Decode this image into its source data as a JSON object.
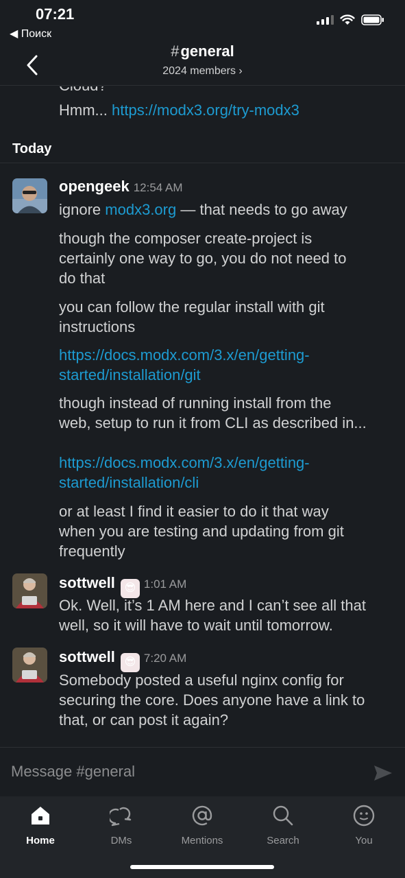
{
  "status_bar": {
    "time": "07:21",
    "back_app": "◀ Поиск"
  },
  "header": {
    "hash": "#",
    "channel": "general",
    "members": "2024 members ›"
  },
  "partial_top": {
    "cut_text": "Cloud?",
    "prefix": "Hmm... ",
    "link": "https://modx3.org/try-modx3"
  },
  "day_separator": "Today",
  "messages": [
    {
      "author": "opengeek",
      "time": "12:54 AM",
      "line1_prefix": "ignore ",
      "line1_link": "modx3.org",
      "line1_suffix": " — that needs to go away",
      "p2_l1": "though the composer create-project is",
      "p2_l2": "certainly one way to go, you do not need to",
      "p2_l3": "do that",
      "p3_l1": "you can follow the regular install with git",
      "p3_l2": "instructions",
      "link1_l1": "https://docs.modx.com/3.x/en/getting-",
      "link1_l2": "started/installation/git",
      "p4_l1": "though instead of running install from the",
      "p4_l2": "web, setup to run it from CLI as described in...",
      "link2_l1": " https://docs.modx.com/3.x/en/getting-",
      "link2_l2": "started/installation/cli",
      "p5_l1": "or at least I find it easier to do it that way",
      "p5_l2": "when you are testing and updating from git",
      "p5_l3": "frequently"
    },
    {
      "author": "sottwell",
      "time": "1:01 AM",
      "l1": "Ok. Well, it’s 1 AM here and I can’t see all that",
      "l2": "well, so it will have to wait until tomorrow."
    },
    {
      "author": "sottwell",
      "time": "7:20 AM",
      "l1": "Somebody posted a useful nginx config for",
      "l2": "securing the core. Does anyone have a link to",
      "l3": "that, or can post it again?"
    }
  ],
  "composer": {
    "placeholder": "Message #general"
  },
  "tabs": [
    {
      "label": "Home",
      "icon": "home-icon"
    },
    {
      "label": "DMs",
      "icon": "dms-icon"
    },
    {
      "label": "Mentions",
      "icon": "mentions-icon"
    },
    {
      "label": "Search",
      "icon": "search-icon"
    },
    {
      "label": "You",
      "icon": "you-icon"
    }
  ],
  "colors": {
    "background": "#1a1d21",
    "link": "#1d9bd1",
    "tabbar": "#222529"
  }
}
